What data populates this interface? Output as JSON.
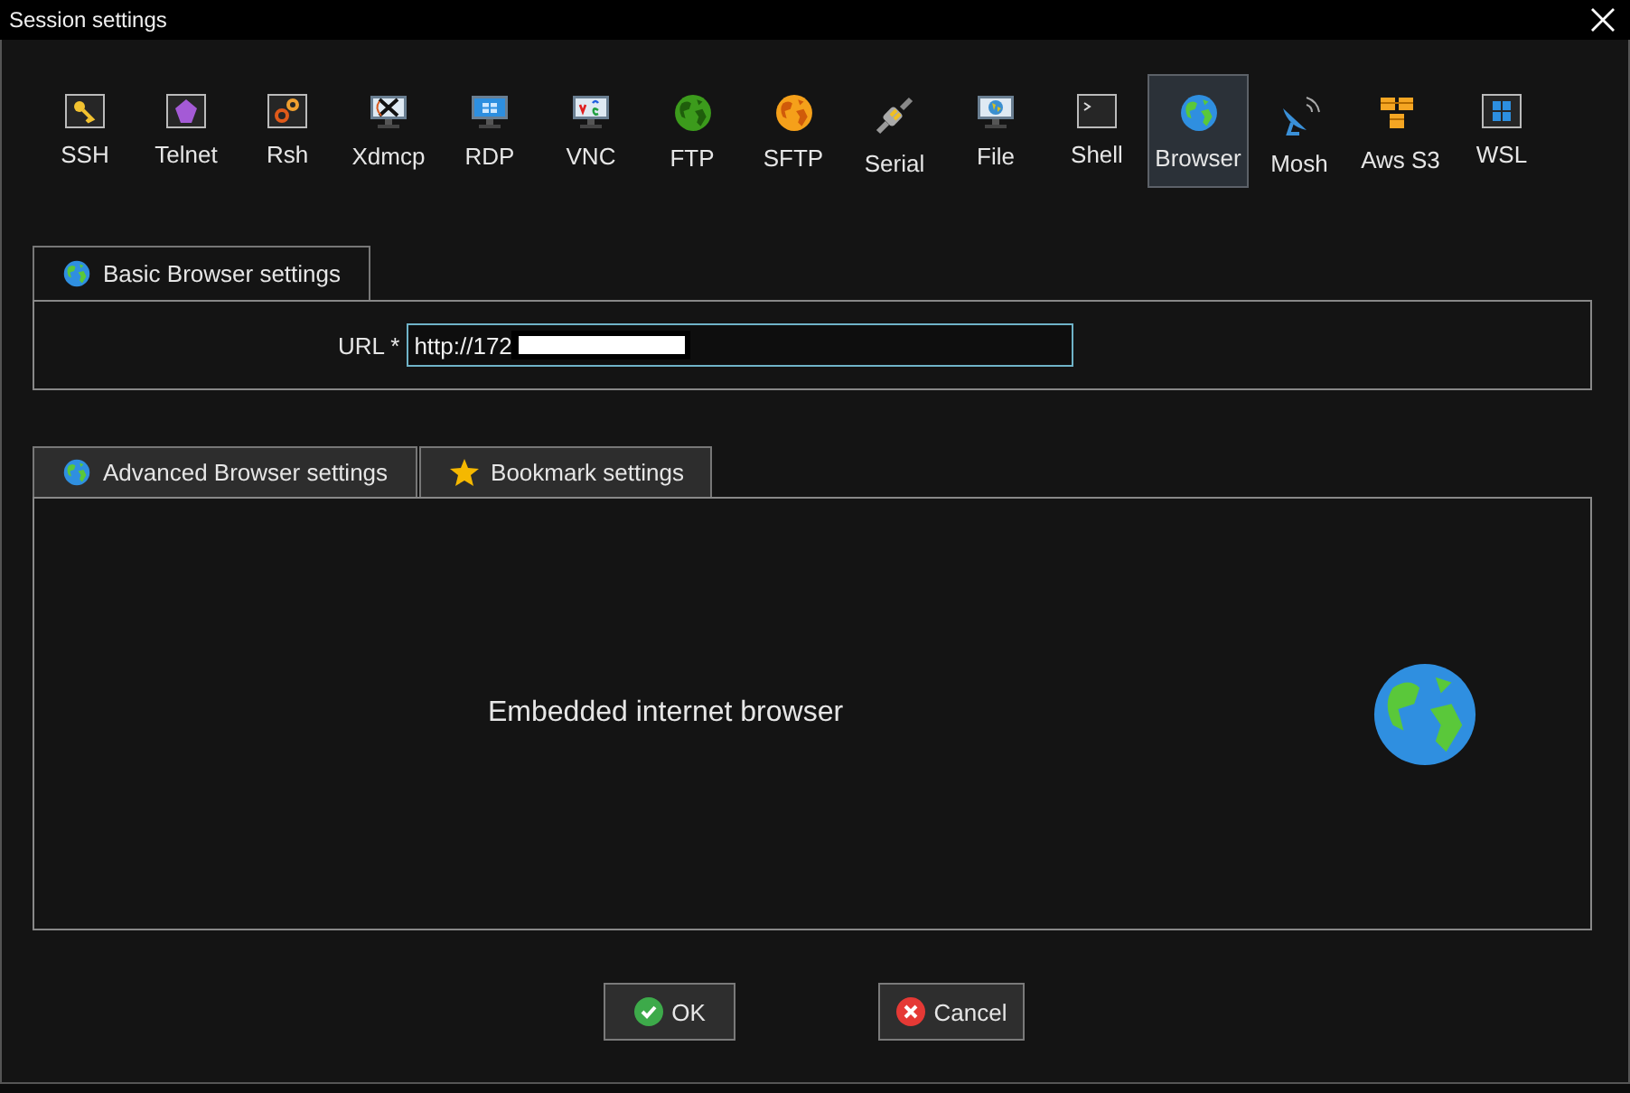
{
  "window": {
    "title": "Session settings"
  },
  "protocols": [
    {
      "label": "SSH",
      "kind": "key",
      "selected": false
    },
    {
      "label": "Telnet",
      "kind": "gem",
      "selected": false
    },
    {
      "label": "Rsh",
      "kind": "gears",
      "selected": false
    },
    {
      "label": "Xdmcp",
      "kind": "xmonitor",
      "selected": false
    },
    {
      "label": "RDP",
      "kind": "winmonitor",
      "selected": false
    },
    {
      "label": "VNC",
      "kind": "vncmonitor",
      "selected": false
    },
    {
      "label": "FTP",
      "kind": "greenglobe",
      "selected": false
    },
    {
      "label": "SFTP",
      "kind": "orangeglobe",
      "selected": false
    },
    {
      "label": "Serial",
      "kind": "plug",
      "selected": false
    },
    {
      "label": "File",
      "kind": "globemonitor",
      "selected": false
    },
    {
      "label": "Shell",
      "kind": "terminal",
      "selected": false
    },
    {
      "label": "Browser",
      "kind": "earth",
      "selected": true
    },
    {
      "label": "Mosh",
      "kind": "dish",
      "selected": false
    },
    {
      "label": "Aws S3",
      "kind": "boxes",
      "selected": false
    },
    {
      "label": "WSL",
      "kind": "windows",
      "selected": false
    }
  ],
  "basic_tab": {
    "label": "Basic Browser settings"
  },
  "url": {
    "label": "URL *",
    "value": "http://172"
  },
  "lower_tabs": [
    {
      "label": "Advanced Browser settings",
      "kind": "earth"
    },
    {
      "label": "Bookmark settings",
      "kind": "star"
    }
  ],
  "panel": {
    "text": "Embedded internet browser"
  },
  "buttons": [
    {
      "label": "OK",
      "kind": "ok"
    },
    {
      "label": "Cancel",
      "kind": "cancel"
    }
  ]
}
